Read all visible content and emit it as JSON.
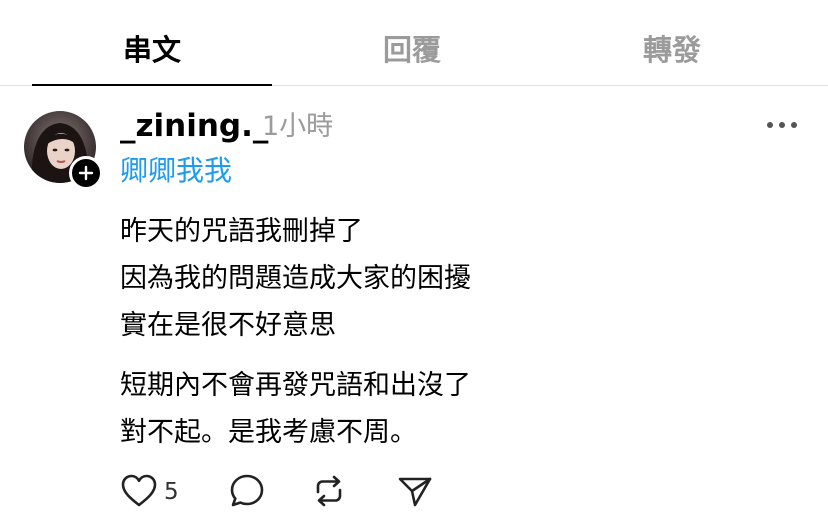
{
  "tabs": [
    {
      "label": "串文",
      "active": true
    },
    {
      "label": "回覆",
      "active": false
    },
    {
      "label": "轉發",
      "active": false
    }
  ],
  "post": {
    "username": "_zining._",
    "timestamp": "1小時",
    "topic": "卿卿我我",
    "paragraphs": [
      [
        "昨天的咒語我刪掉了",
        "因為我的問題造成大家的困擾",
        "實在是很不好意思"
      ],
      [
        "短期內不會再發咒語和出沒了",
        "對不起。是我考慮不周。"
      ]
    ],
    "like_count": "5"
  },
  "icons": {
    "more": "more-horizontal-icon",
    "follow": "plus-icon",
    "like": "heart-icon",
    "comment": "comment-bubble-icon",
    "repost": "repost-icon",
    "share": "send-icon"
  },
  "colors": {
    "text": "#000000",
    "muted": "#9b9b9b",
    "topic": "#1d9bf0",
    "divider": "#e3e3e3"
  }
}
